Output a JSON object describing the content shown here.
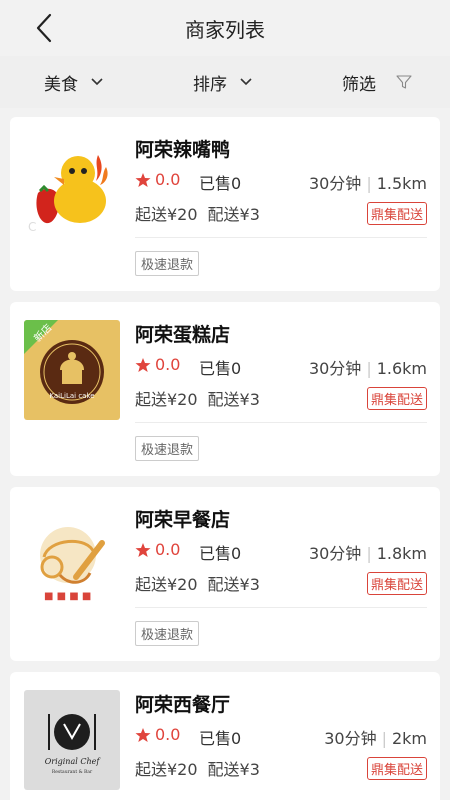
{
  "header": {
    "title": "商家列表"
  },
  "filters": [
    {
      "label": "美食"
    },
    {
      "label": "排序"
    },
    {
      "label": "筛选"
    }
  ],
  "merchants": [
    {
      "name": "阿荣辣嘴鸭",
      "rating": "0.0",
      "sold": "已售0",
      "time": "30分钟",
      "distance": "1.5km",
      "min_order": "起送¥20",
      "delivery_fee": "配送¥3",
      "badge": "鼎集配送",
      "tag": "极速退款",
      "logo": "duck"
    },
    {
      "name": "阿荣蛋糕店",
      "rating": "0.0",
      "sold": "已售0",
      "time": "30分钟",
      "distance": "1.6km",
      "min_order": "起送¥20",
      "delivery_fee": "配送¥3",
      "badge": "鼎集配送",
      "tag": "极速退款",
      "logo": "cake",
      "logo_text": "KaiLiLai cake",
      "ribbon": "新店"
    },
    {
      "name": "阿荣早餐店",
      "rating": "0.0",
      "sold": "已售0",
      "time": "30分钟",
      "distance": "1.8km",
      "min_order": "起送¥20",
      "delivery_fee": "配送¥3",
      "badge": "鼎集配送",
      "tag": "极速退款",
      "logo": "breakfast"
    },
    {
      "name": "阿荣西餐厅",
      "rating": "0.0",
      "sold": "已售0",
      "time": "30分钟",
      "distance": "2km",
      "min_order": "起送¥20",
      "delivery_fee": "配送¥3",
      "badge": "鼎集配送",
      "logo": "chef",
      "logo_text": "Original Chef",
      "logo_subtext": "Restaurant & Bar"
    }
  ],
  "colors": {
    "accent": "#e0443c",
    "background": "#f2f2f2"
  }
}
